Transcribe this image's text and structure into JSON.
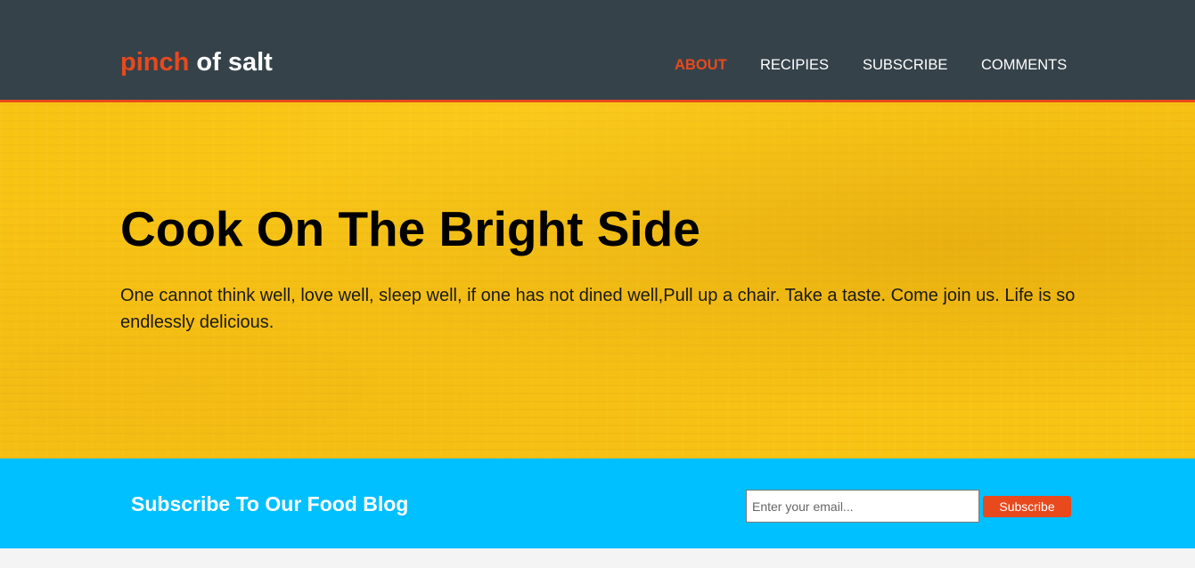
{
  "brand": {
    "highlight": "pinch",
    "rest": " of salt"
  },
  "nav": {
    "items": [
      {
        "label": "ABOUT",
        "current": true
      },
      {
        "label": "RECIPIES",
        "current": false
      },
      {
        "label": "SUBSCRIBE",
        "current": false
      },
      {
        "label": "COMMENTS",
        "current": false
      }
    ]
  },
  "showcase": {
    "title": "Cook On The Bright Side",
    "text": "One cannot think well, love well, sleep well, if one has not dined well,Pull up a chair. Take a taste. Come join us. Life is so endlessly delicious."
  },
  "newsletter": {
    "title": "Subscribe To Our Food Blog",
    "email_value": "",
    "email_placeholder": "Enter your email...",
    "button_label": "Subscribe"
  },
  "colors": {
    "header_bg": "#35424a",
    "accent": "#e8491d",
    "showcase_bg": "#f8c414",
    "newsletter_bg": "#00c0ff",
    "page_bg": "#f4f4f4"
  }
}
